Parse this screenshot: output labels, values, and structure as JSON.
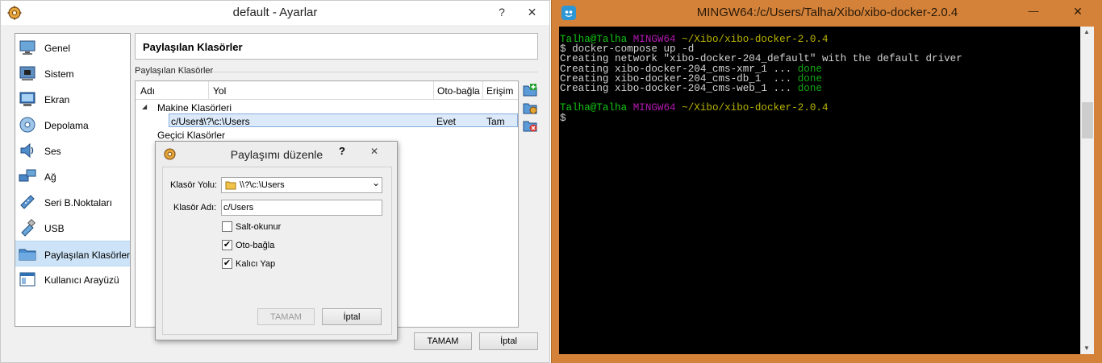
{
  "settings_window": {
    "title": "default - Ayarlar",
    "help_glyph": "?",
    "close_glyph": "✕",
    "sidebar": [
      {
        "label": "Genel",
        "icon": "monitor-icon"
      },
      {
        "label": "Sistem",
        "icon": "chip-icon"
      },
      {
        "label": "Ekran",
        "icon": "display-icon"
      },
      {
        "label": "Depolama",
        "icon": "disk-icon"
      },
      {
        "label": "Ses",
        "icon": "speaker-icon"
      },
      {
        "label": "Ağ",
        "icon": "network-icon"
      },
      {
        "label": "Seri B.Noktaları",
        "icon": "serial-port-icon"
      },
      {
        "label": "USB",
        "icon": "usb-icon"
      },
      {
        "label": "Paylaşılan Klasörler",
        "icon": "folder-icon",
        "selected": true
      },
      {
        "label": "Kullanıcı Arayüzü",
        "icon": "window-icon"
      }
    ],
    "page_title": "Paylaşılan Klasörler",
    "group_label": "Paylaşılan Klasörler",
    "columns": {
      "name": "Adı",
      "path": "Yol",
      "automount": "Oto-bağla",
      "access": "Erişim"
    },
    "tree": {
      "machine_group": "Makine Klasörleri",
      "row": {
        "name": "c/Users",
        "path": "\\\\?\\c:\\Users",
        "automount": "Evet",
        "access": "Tam"
      },
      "transient_group": "Geçici Klasörler",
      "expander_glyph": "◢"
    },
    "ok_button": "TAMAM",
    "cancel_button": "İptal"
  },
  "edit_dialog": {
    "title": "Paylaşımı düzenle",
    "help_glyph": "?",
    "close_glyph": "✕",
    "folder_path_label": "Klasör Yolu:",
    "folder_path_value": "\\\\?\\c:\\Users",
    "folder_name_label": "Klasör Adı:",
    "folder_name_value": "c/Users",
    "check_readonly": {
      "label": "Salt-okunur",
      "checked": false
    },
    "check_automount": {
      "label": "Oto-bağla",
      "checked": true
    },
    "check_permanent": {
      "label": "Kalıcı Yap",
      "checked": true
    },
    "check_glyph": "✔",
    "dropdown_glyph": "⌄",
    "ok_button": "TAMAM",
    "cancel_button": "İptal"
  },
  "terminal": {
    "title": "MINGW64:/c/Users/Talha/Xibo/xibo-docker-2.0.4",
    "minimize_glyph": "—",
    "close_glyph": "✕",
    "prompt_user": "Talha@Talha",
    "prompt_env": "MINGW64",
    "prompt_path": "~/Xibo/xibo-docker-2.0.4",
    "command": "$ docker-compose up -d",
    "output_network": "Creating network \"xibo-docker-204_default\" with the default driver",
    "output_xmr": "Creating xibo-docker-204_cms-xmr_1 ... ",
    "output_db": "Creating xibo-docker-204_cms-db_1  ... ",
    "output_web": "Creating xibo-docker-204_cms-web_1 ... ",
    "done_text": "done",
    "prompt_symbol": "$",
    "scroll_up_glyph": "▲",
    "scroll_down_glyph": "▼"
  },
  "colors": {
    "terminal_titlebar": "#d4823a",
    "terminal_bg": "#000000",
    "prompt_green": "#12c712",
    "prompt_purple": "#b31ab3",
    "prompt_yellow": "#b8b300",
    "selection_blue": "#cde3f7"
  }
}
